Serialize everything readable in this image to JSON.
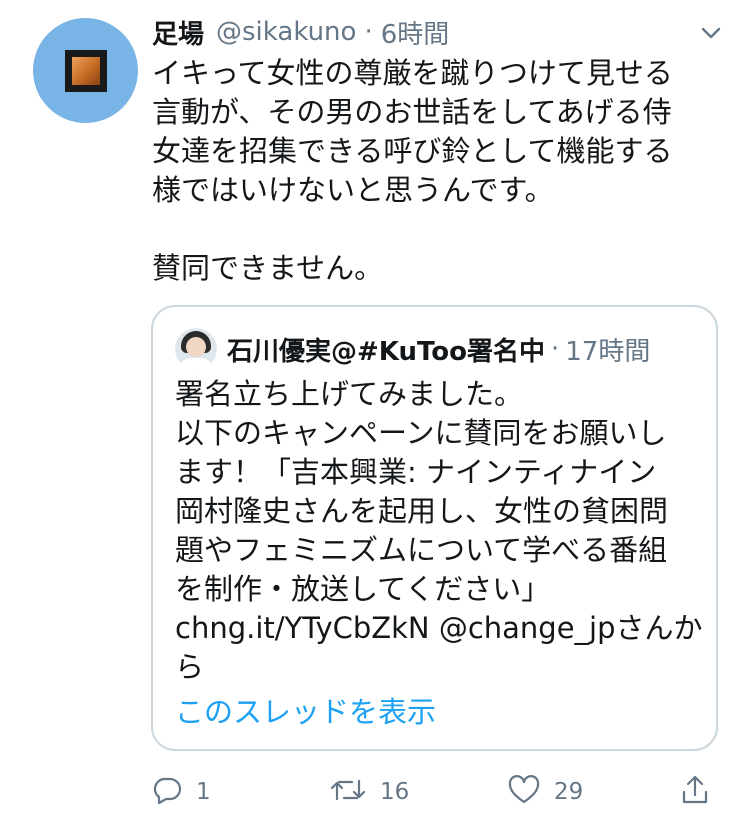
{
  "tweet": {
    "display_name": "足場",
    "handle": "@sikakuno",
    "separator": "·",
    "time": "6時間",
    "text": "イキって女性の尊厳を蹴りつけて見せる\n言動が、その男のお世話をしてあげる侍\n女達を招集できる呼び鈴として機能する\n様ではいけないと思うんです。\n\n賛同できません。"
  },
  "quoted": {
    "display_name": "石川優実@#KuToo署名中",
    "separator": "·",
    "time": "17時間",
    "text": "署名立ち上げてみました。\n以下のキャンペーンに賛同をお願いし\nます！「吉本興業: ナインティナイン\n岡村隆史さんを起用し、女性の貧困問\n題やフェミニズムについて学べる番組\nを制作・放送してください」\nchng.it/YTyCbZkN @change_jpさんか\nら",
    "show_thread": "このスレッドを表示"
  },
  "actions": {
    "reply_count": "1",
    "retweet_count": "16",
    "like_count": "29"
  },
  "colors": {
    "accent": "#1da1f2",
    "muted": "#657786",
    "border": "#ccd6dd",
    "avatar_bg": "#79b4e6"
  },
  "icons": {
    "reply": "reply-icon",
    "retweet": "retweet-icon",
    "like": "heart-icon",
    "share": "share-icon",
    "menu": "chevron-down-icon"
  }
}
